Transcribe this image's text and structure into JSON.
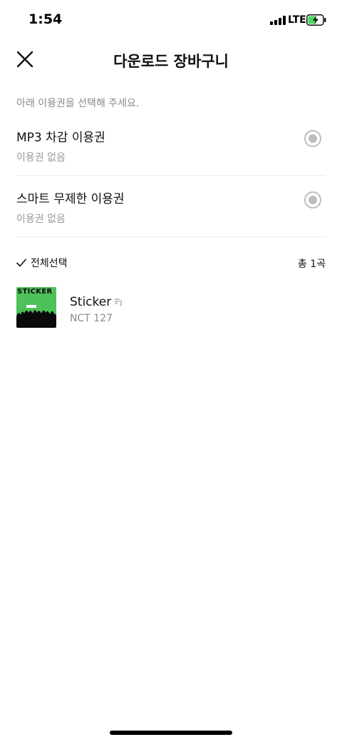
{
  "status_bar": {
    "time": "1:54",
    "network": "LTE",
    "battery_color": "#4cd964",
    "signal_icon": "signal-bars-icon",
    "battery_icon": "battery-charging-icon"
  },
  "header": {
    "title": "다운로드 장바구니",
    "close_icon": "close-icon"
  },
  "instruction": "아래 이용권을 선택해 주세요.",
  "options": [
    {
      "title": "MP3 차감 이용권",
      "subtitle": "이용권 없음",
      "selected": false
    },
    {
      "title": "스마트 무제한 이용권",
      "subtitle": "이용권 없음",
      "selected": false
    }
  ],
  "selection": {
    "select_all_label": "전체선택",
    "total_label": "총 1곡",
    "check_icon": "checkmark-icon"
  },
  "songs": [
    {
      "title": "Sticker",
      "artist": "NCT 127",
      "album_text": "STICKER",
      "album_color": "#4fc15a",
      "lyric_icon": "lyrics-icon"
    }
  ]
}
